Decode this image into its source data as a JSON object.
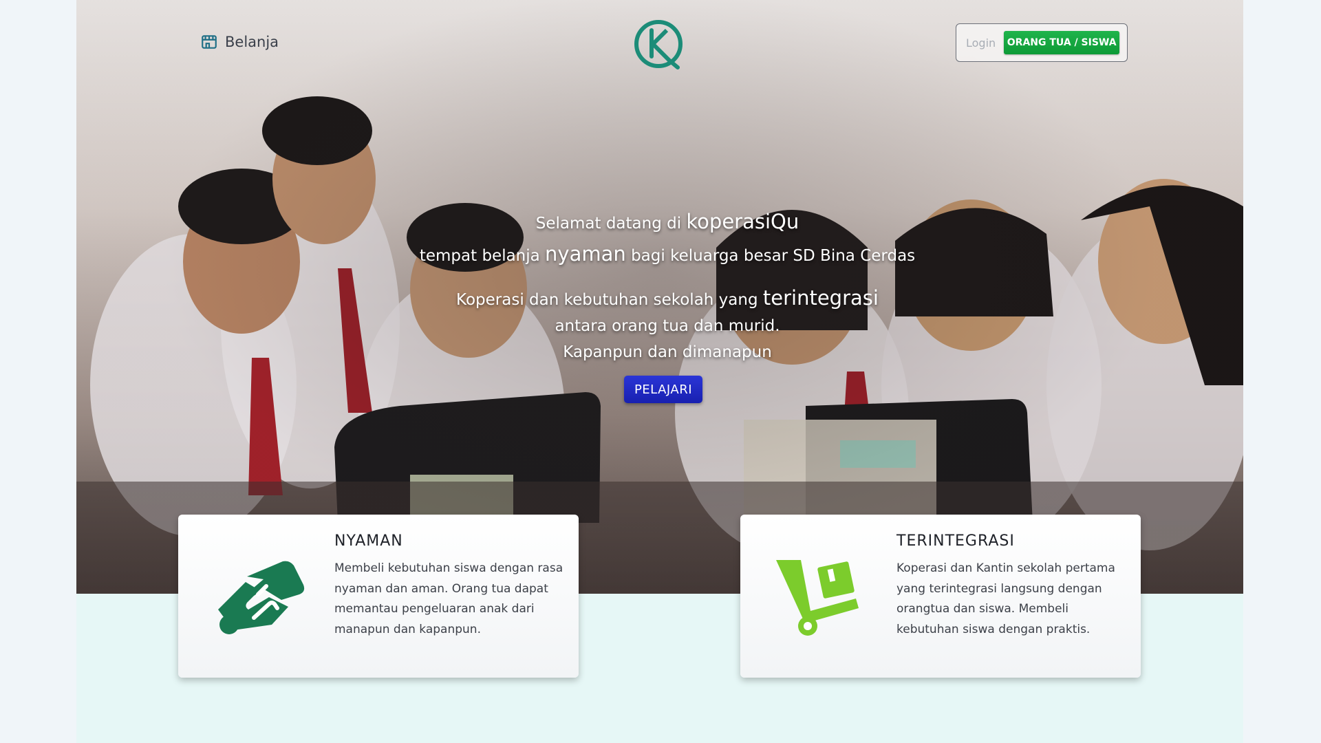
{
  "nav": {
    "shop_label": "Belanja",
    "login_label": "Login",
    "login_button": "ORANG TUA / SISWA"
  },
  "hero": {
    "welcome_prefix": "Selamat datang di ",
    "welcome_brand": "koperasiQu",
    "tagline_prefix": "tempat belanja ",
    "tagline_emph": "nyaman",
    "tagline_suffix": " bagi keluarga besar SD Bina Cerdas",
    "line3_prefix": "Koperasi dan kebutuhan sekolah yang ",
    "line3_emph": "terintegrasi",
    "line4": "antara orang tua dan murid.",
    "line5": "Kapanpun dan dimanapun",
    "cta_label": "PELAJARI"
  },
  "cards": [
    {
      "title": "NYAMAN",
      "description": "Membeli kebutuhan siswa dengan rasa nyaman dan aman. Orang tua dapat memantau pengeluaran anak dari manapun dan kapanpun.",
      "icon": "handshake-icon"
    },
    {
      "title": "TERINTEGRASI",
      "description": "Koperasi dan Kantin sekolah pertama yang terintegrasi langsung dengan orangtua dan siswa. Membeli kebutuhan siswa dengan praktis.",
      "icon": "hand-truck-icon"
    }
  ],
  "colors": {
    "brand_teal": "#1c8c78",
    "login_green": "#12a53d",
    "cta_blue": "#1f28c4",
    "handshake_green": "#1a7a52",
    "truck_green": "#7ccc2c"
  }
}
